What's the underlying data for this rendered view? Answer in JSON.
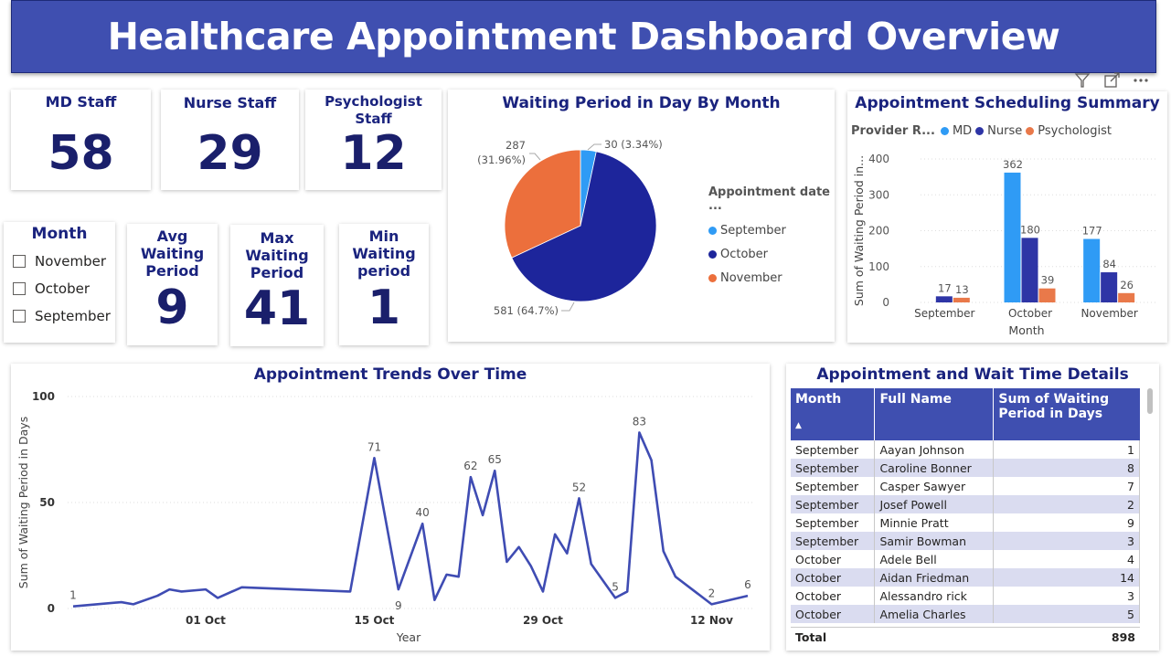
{
  "header": {
    "title": "Healthcare Appointment Dashboard Overview"
  },
  "toolbar": {
    "icons": [
      "filter-icon",
      "focus-mode-icon",
      "more-options-icon"
    ]
  },
  "kpis": {
    "md_staff": {
      "label": "MD Staff",
      "value": "58"
    },
    "nurse_staff": {
      "label": "Nurse Staff",
      "value": "29"
    },
    "psych_staff": {
      "label": "Psychologist Staff",
      "value": "12"
    },
    "avg_wait": {
      "label": "Avg Waiting Period",
      "value": "9"
    },
    "max_wait": {
      "label": "Max Waiting Period",
      "value": "41"
    },
    "min_wait": {
      "label": "Min Waiting period",
      "value": "1"
    }
  },
  "slicer": {
    "title": "Month",
    "items": [
      {
        "label": "November"
      },
      {
        "label": "October"
      },
      {
        "label": "September"
      }
    ]
  },
  "colors": {
    "september": "#2f9bf5",
    "october": "#1d259b",
    "november": "#ec6f3c",
    "md": "#2f9bf5",
    "nurse": "#2e35a6",
    "psychologist": "#e9794a",
    "line": "#3f4cb3",
    "header_blue": "#3f4fb0"
  },
  "chart_data": [
    {
      "type": "pie",
      "title": "Waiting Period in Day By Month",
      "legend_title": "Appointment date ...",
      "legend_position": "right",
      "slices": [
        {
          "label": "September",
          "value": 30,
          "display": "30 (3.34%)"
        },
        {
          "label": "October",
          "value": 581,
          "display": "581 (64.7%)"
        },
        {
          "label": "November",
          "value": 287,
          "display": "287 (31.96%)"
        }
      ]
    },
    {
      "type": "bar",
      "title": "Appointment Scheduling Summary",
      "legend_title": "Provider R...",
      "legend_position": "top-left",
      "xlabel": "Month",
      "ylabel": "Sum of Waiting Period in...",
      "ylim": [
        0,
        400
      ],
      "yticks": [
        0,
        100,
        200,
        300,
        400
      ],
      "grid": true,
      "categories": [
        "September",
        "October",
        "November"
      ],
      "series": [
        {
          "name": "MD",
          "values": [
            0,
            362,
            177
          ],
          "labels": [
            "",
            "362",
            "177"
          ]
        },
        {
          "name": "Nurse",
          "values": [
            17,
            180,
            84
          ],
          "labels": [
            "17",
            "180",
            "84"
          ]
        },
        {
          "name": "Psychologist",
          "values": [
            13,
            39,
            26
          ],
          "labels": [
            "13",
            "39",
            "26"
          ]
        }
      ]
    },
    {
      "type": "line",
      "title": "Appointment Trends Over Time",
      "xlabel": "Year",
      "ylabel": "Sum of Waiting Period in Days",
      "ylim": [
        0,
        100
      ],
      "yticks": [
        0,
        50,
        100
      ],
      "grid": true,
      "xticks": [
        {
          "date": "2024-10-01",
          "label": "01 Oct"
        },
        {
          "date": "2024-10-15",
          "label": "15 Oct"
        },
        {
          "date": "2024-10-29",
          "label": "29 Oct"
        },
        {
          "date": "2024-11-12",
          "label": "12 Nov"
        }
      ],
      "x": [
        "2024-09-20",
        "2024-09-24",
        "2024-09-25",
        "2024-09-27",
        "2024-09-28",
        "2024-09-29",
        "2024-10-01",
        "2024-10-02",
        "2024-10-04",
        "2024-10-13",
        "2024-10-15",
        "2024-10-17",
        "2024-10-19",
        "2024-10-20",
        "2024-10-21",
        "2024-10-22",
        "2024-10-23",
        "2024-10-24",
        "2024-10-25",
        "2024-10-26",
        "2024-10-27",
        "2024-10-28",
        "2024-10-29",
        "2024-10-30",
        "2024-10-31",
        "2024-11-01",
        "2024-11-02",
        "2024-11-04",
        "2024-11-05",
        "2024-11-06",
        "2024-11-07",
        "2024-11-08",
        "2024-11-09",
        "2024-11-12",
        "2024-11-15"
      ],
      "y": [
        1,
        3,
        2,
        6,
        9,
        8,
        9,
        5,
        10,
        8,
        71,
        9,
        40,
        4,
        16,
        15,
        62,
        44,
        65,
        22,
        29,
        20,
        8,
        35,
        26,
        52,
        21,
        5,
        8,
        83,
        70,
        27,
        15,
        2,
        6
      ],
      "point_labels": [
        {
          "index": 0,
          "text": "1"
        },
        {
          "index": 10,
          "text": "71"
        },
        {
          "index": 11,
          "text": "9"
        },
        {
          "index": 12,
          "text": "40"
        },
        {
          "index": 16,
          "text": "62"
        },
        {
          "index": 18,
          "text": "65"
        },
        {
          "index": 25,
          "text": "52"
        },
        {
          "index": 27,
          "text": "5"
        },
        {
          "index": 29,
          "text": "83"
        },
        {
          "index": 33,
          "text": "2"
        },
        {
          "index": 34,
          "text": "6"
        }
      ]
    }
  ],
  "table": {
    "title": "Appointment and Wait Time Details",
    "columns": [
      "Month",
      "Full Name",
      "Sum of Waiting Period in Days"
    ],
    "sort_indicator": "▲",
    "rows": [
      [
        "September",
        "Aayan Johnson",
        "1"
      ],
      [
        "September",
        "Caroline Bonner",
        "8"
      ],
      [
        "September",
        "Casper Sawyer",
        "7"
      ],
      [
        "September",
        "Josef Powell",
        "2"
      ],
      [
        "September",
        "Minnie Pratt",
        "9"
      ],
      [
        "September",
        "Samir Bowman",
        "3"
      ],
      [
        "October",
        "Adele Bell",
        "4"
      ],
      [
        "October",
        "Aidan Friedman",
        "14"
      ],
      [
        "October",
        "Alessandro rick",
        "3"
      ],
      [
        "October",
        "Amelia Charles",
        "5"
      ]
    ],
    "total_label": "Total",
    "total_value": "898"
  }
}
